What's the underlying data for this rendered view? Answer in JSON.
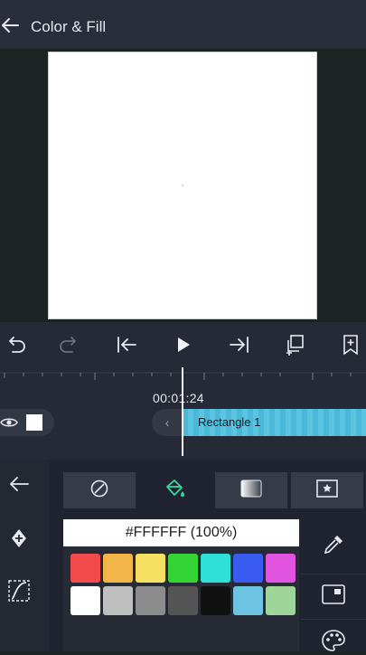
{
  "header": {
    "title": "Color & Fill",
    "back_icon": "arrow-left-icon"
  },
  "timeline": {
    "timecode": "00:01:24",
    "layer_label": "Rectangle 1"
  },
  "fill_panel": {
    "hex_value": "#FFFFFF (100%)",
    "tabs": [
      "no-fill-icon",
      "paint-bucket-icon",
      "gradient-icon",
      "image-fill-icon"
    ],
    "active_tab": 1
  },
  "palette": [
    [
      "#f24a4a",
      "#f2b54a",
      "#f5e062",
      "#33d433",
      "#2fe0d8",
      "#3a5cf0",
      "#e054e0"
    ],
    [
      "#ffffff",
      "#bfbfbf",
      "#8c8c8c",
      "#555555",
      "#111111",
      "#6cc4e2",
      "#9fd49a"
    ]
  ],
  "colors": {
    "accent": "#3bd6a2",
    "clip": "#4ab8d8",
    "topbar": "#2a2e3b"
  }
}
